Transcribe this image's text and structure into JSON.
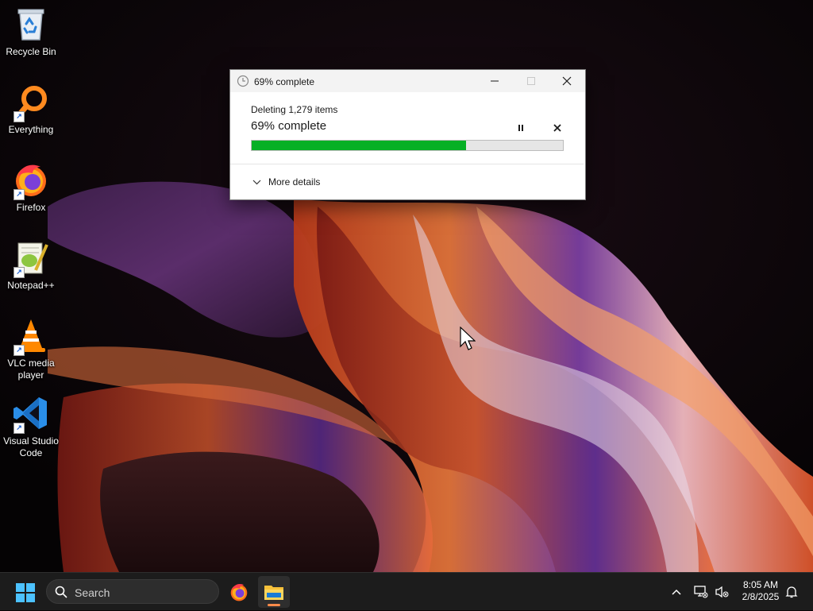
{
  "desktop": {
    "icons": [
      {
        "label": "Recycle Bin",
        "icon": "recycle-bin-icon",
        "shortcut": false
      },
      {
        "label": "Everything",
        "icon": "everything-search-icon",
        "shortcut": true
      },
      {
        "label": "Firefox",
        "icon": "firefox-icon",
        "shortcut": true
      },
      {
        "label": "Notepad++",
        "icon": "notepad-plus-plus-icon",
        "shortcut": true
      },
      {
        "label": "VLC media player",
        "icon": "vlc-cone-icon",
        "shortcut": true
      },
      {
        "label": "Visual Studio Code",
        "icon": "vscode-icon",
        "shortcut": true
      }
    ]
  },
  "dialog": {
    "title": "69% complete",
    "operation": "Deleting 1,279 items",
    "status": "69% complete",
    "progress_fraction": 0.69,
    "more_details": "More details",
    "progress_color": "#06b025"
  },
  "taskbar": {
    "search_placeholder": "Search",
    "apps": [
      "firefox-icon",
      "file-explorer-icon"
    ],
    "clock_time": "8:05 AM",
    "clock_date": "2/8/2025"
  }
}
